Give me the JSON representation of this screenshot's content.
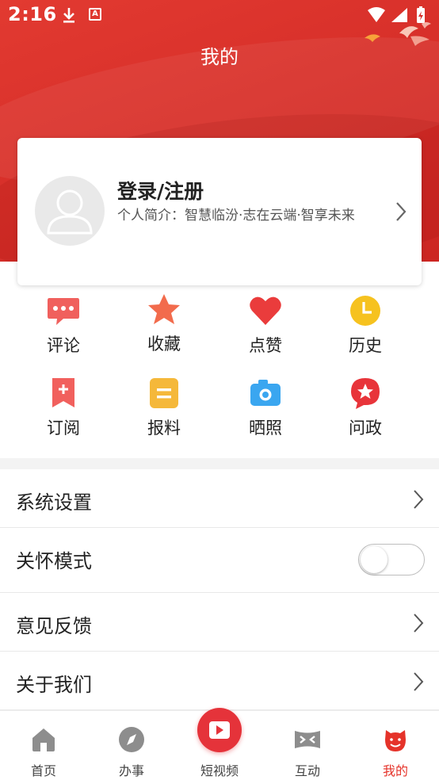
{
  "status": {
    "time": "2:16"
  },
  "header": {
    "title": "我的"
  },
  "profile": {
    "login_label": "登录/注册",
    "bio": "个人简介：智慧临汾·志在云端·智享未来"
  },
  "grid": {
    "row1": [
      {
        "label": "评论",
        "icon": "comment-icon",
        "color": "#f0605d"
      },
      {
        "label": "收藏",
        "icon": "star-icon",
        "color": "#f26b4c"
      },
      {
        "label": "点赞",
        "icon": "heart-icon",
        "color": "#ea3c3c"
      },
      {
        "label": "历史",
        "icon": "clock-icon",
        "color": "#f6c21f"
      }
    ],
    "row2": [
      {
        "label": "订阅",
        "icon": "bookmark-icon",
        "color": "#f1605d"
      },
      {
        "label": "报料",
        "icon": "report-icon",
        "color": "#f5b83a"
      },
      {
        "label": "晒照",
        "icon": "camera-icon",
        "color": "#3aa6f0"
      },
      {
        "label": "问政",
        "icon": "question-star-icon",
        "color": "#e8343a"
      }
    ]
  },
  "settings": {
    "system": "系统设置",
    "care_mode": "关怀模式",
    "care_mode_on": false,
    "feedback": "意见反馈",
    "about": "关于我们"
  },
  "tabs": [
    {
      "label": "首页",
      "icon": "home-icon"
    },
    {
      "label": "办事",
      "icon": "compass-icon"
    },
    {
      "label": "短视频",
      "icon": "play-icon"
    },
    {
      "label": "互动",
      "icon": "interact-icon"
    },
    {
      "label": "我的",
      "icon": "profile-face-icon",
      "active": true
    }
  ],
  "colors": {
    "accent": "#e5332a",
    "header": "#d8302a"
  }
}
